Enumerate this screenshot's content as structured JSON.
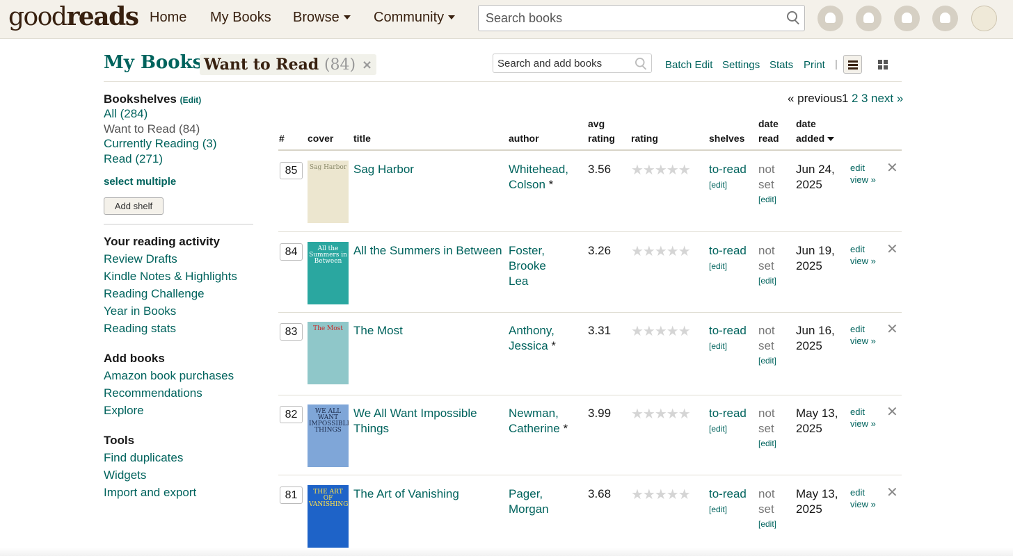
{
  "header": {
    "logo": {
      "light": "good",
      "bold": "reads"
    },
    "nav": [
      "Home",
      "My Books",
      "Browse",
      "Community"
    ],
    "search_placeholder": "Search books"
  },
  "page": {
    "title": "My Books:",
    "shelf_chip": {
      "name": "Want to Read",
      "count": "(84)",
      "remove": "×"
    },
    "search_add_placeholder": "Search and add books",
    "tools": [
      "Batch Edit",
      "Settings",
      "Stats",
      "Print"
    ],
    "tool_sep": "|"
  },
  "sidebar": {
    "bookshelves_label": "Bookshelves",
    "edit_label": "(Edit)",
    "shelves": [
      "All (284)",
      "Want to Read (84)",
      "Currently Reading (3)",
      "Read (271)"
    ],
    "select_multiple": "select multiple",
    "add_shelf": "Add shelf",
    "activity_head": "Your reading activity",
    "activity": [
      "Review Drafts",
      "Kindle Notes & Highlights",
      "Reading Challenge",
      "Year in Books",
      "Reading stats"
    ],
    "addbooks_head": "Add books",
    "addbooks": [
      "Amazon book purchases",
      "Recommendations",
      "Explore"
    ],
    "tools_head": "Tools",
    "tools": [
      "Find duplicates",
      "Widgets",
      "Import and export"
    ]
  },
  "pagination": {
    "previous": "« previous",
    "current": "1",
    "pages": [
      "2",
      "3"
    ],
    "next": "next »"
  },
  "table": {
    "headers": {
      "num": "#",
      "cover": "cover",
      "title": "title",
      "author": "author",
      "avg1": "avg",
      "avg2": "rating",
      "rating": "rating",
      "shelves": "shelves",
      "read1": "date",
      "read2": "read",
      "added1": "date",
      "added2": "added"
    },
    "stars": "★★★★★",
    "rows": [
      {
        "pos": "85",
        "title": "Sag Harbor",
        "author1": "Whitehead,",
        "author2": "Colson",
        "author_star": " *",
        "avg": "3.56",
        "shelf": "to-read",
        "shelf_edit": "[edit]",
        "read1": "not",
        "read2": "set",
        "read_edit": "[edit]",
        "added1": "Jun 24,",
        "added2": "2025",
        "edit": "edit",
        "view": "view »",
        "del": "✕"
      },
      {
        "pos": "84",
        "title": "All the Summers in Between",
        "author1": "Foster, Brooke",
        "author2": "Lea",
        "author_star": "",
        "avg": "3.26",
        "shelf": "to-read",
        "shelf_edit": "[edit]",
        "read1": "not",
        "read2": "set",
        "read_edit": "[edit]",
        "added1": "Jun 19,",
        "added2": "2025",
        "edit": "edit",
        "view": "view »",
        "del": "✕"
      },
      {
        "pos": "83",
        "title": "The Most",
        "author1": "Anthony,",
        "author2": "Jessica",
        "author_star": " *",
        "avg": "3.31",
        "shelf": "to-read",
        "shelf_edit": "[edit]",
        "read1": "not",
        "read2": "set",
        "read_edit": "[edit]",
        "added1": "Jun 16,",
        "added2": "2025",
        "edit": "edit",
        "view": "view »",
        "del": "✕"
      },
      {
        "pos": "82",
        "title": "We All Want Impossible Things",
        "author1": "Newman,",
        "author2": "Catherine",
        "author_star": " *",
        "avg": "3.99",
        "shelf": "to-read",
        "shelf_edit": "[edit]",
        "read1": "not",
        "read2": "set",
        "read_edit": "[edit]",
        "added1": "May 13,",
        "added2": "2025",
        "edit": "edit",
        "view": "view »",
        "del": "✕"
      },
      {
        "pos": "81",
        "title": "The Art of Vanishing",
        "author1": "Pager, Morgan",
        "author2": "",
        "author_star": "",
        "avg": "3.68",
        "shelf": "to-read",
        "shelf_edit": "[edit]",
        "read1": "not",
        "read2": "set",
        "read_edit": "[edit]",
        "added1": "May 13,",
        "added2": "2025",
        "edit": "edit",
        "view": "view »",
        "del": "✕"
      }
    ]
  },
  "covers": [
    {
      "bg": "#ece6cf",
      "fg": "#8a8a6a",
      "text": "Sag Harbor"
    },
    {
      "bg": "#2aa7a0",
      "fg": "#ffffff",
      "text": "All the Summers in Between"
    },
    {
      "bg": "#8fc7c9",
      "fg": "#c62828",
      "text": "The Most"
    },
    {
      "bg": "#7fa6d8",
      "fg": "#1b2a4a",
      "text": "WE ALL WANT IMPOSSIBLE THINGS"
    },
    {
      "bg": "#1e63c8",
      "fg": "#ffe14a",
      "text": "THE ART OF VANISHING"
    }
  ],
  "colors": {
    "accent": "#00635d",
    "header_bg": "#f4f1ea",
    "brand": "#382110"
  }
}
